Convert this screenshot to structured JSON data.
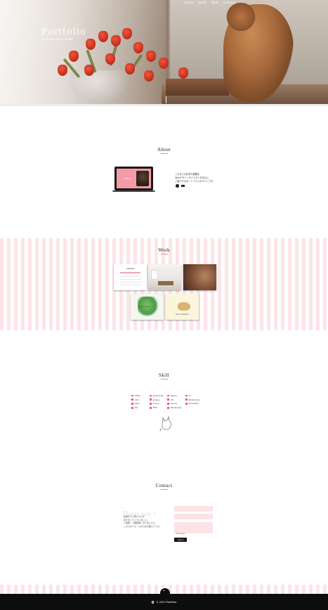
{
  "nav": {
    "items": [
      "About",
      "Work",
      "Skill",
      "Contact"
    ]
  },
  "hero": {
    "title": "Portfolio",
    "subtitle": "My creative works and skills"
  },
  "about": {
    "title": "About",
    "laptop_text": "Portfolio",
    "text": [
      "これまでの仕事や経験を",
      "Webデザインやイラストを中心に",
      "ご紹介するポートフォリオサイトです。"
    ]
  },
  "work": {
    "title": "Work",
    "cards": [
      {
        "heading": "Café Menu"
      },
      {
        "heading": ""
      },
      {
        "heading": ""
      },
      {
        "heading": "Green Garden"
      },
      {
        "heading": "bear illustration"
      }
    ]
  },
  "skill": {
    "title": "Skill",
    "columns": [
      [
        "HTML",
        "CSS",
        "Sass",
        "Git"
      ],
      [
        "JavaScript",
        "jQuery",
        "Vue.js",
        "PHP"
      ],
      [
        "Figma",
        "XD",
        "Canva",
        "Wordpress"
      ],
      [
        "AI",
        "Photoshop",
        "Illustrator"
      ]
    ]
  },
  "contact": {
    "title": "Contact",
    "thanks": "Thank you !",
    "message": [
      "最後までご覧いただき",
      "ありがとうございました。",
      "ご依頼・ご相談等ございましたら",
      "こちらのフォームからお気軽にどうぞ。"
    ],
    "fields": {
      "name": "Name",
      "email": "Email",
      "message": "Message"
    },
    "send": "Send"
  },
  "footer": {
    "copyright": "© 2023 Portfolio"
  },
  "colors": {
    "accent": "#e15c78",
    "stripe": "#fde4e8",
    "dark": "#0d0d0d"
  }
}
